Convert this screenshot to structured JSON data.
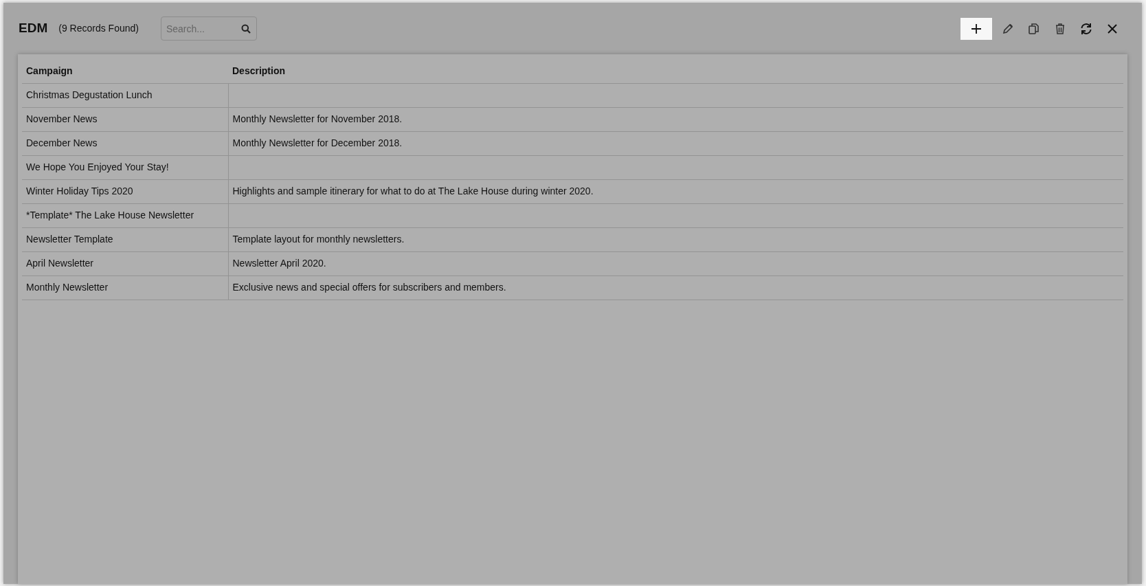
{
  "header": {
    "title": "EDM",
    "record_count": "(9 Records Found)",
    "search": {
      "placeholder": "Search..."
    }
  },
  "toolbar": [
    {
      "kind": "add",
      "highlighted": true
    },
    {
      "kind": "edit",
      "highlighted": false
    },
    {
      "kind": "copy",
      "highlighted": false
    },
    {
      "kind": "delete",
      "highlighted": false
    },
    {
      "kind": "refresh",
      "highlighted": false
    },
    {
      "kind": "close",
      "highlighted": false
    }
  ],
  "table": {
    "columns": [
      "Campaign",
      "Description"
    ],
    "rows": [
      [
        "Christmas Degustation Lunch",
        ""
      ],
      [
        "November News",
        "Monthly Newsletter for November 2018."
      ],
      [
        "December News",
        "Monthly Newsletter for December 2018."
      ],
      [
        "We Hope You Enjoyed Your Stay!",
        ""
      ],
      [
        "Winter Holiday Tips 2020",
        "Highlights and sample itinerary for what to do at The Lake House during winter 2020."
      ],
      [
        "*Template* The Lake House Newsletter",
        ""
      ],
      [
        "Newsletter Template",
        "Template layout for monthly newsletters."
      ],
      [
        "April Newsletter",
        "Newsletter April 2020."
      ],
      [
        "Monthly Newsletter",
        "Exclusive news and special offers for subscribers and members."
      ]
    ]
  }
}
